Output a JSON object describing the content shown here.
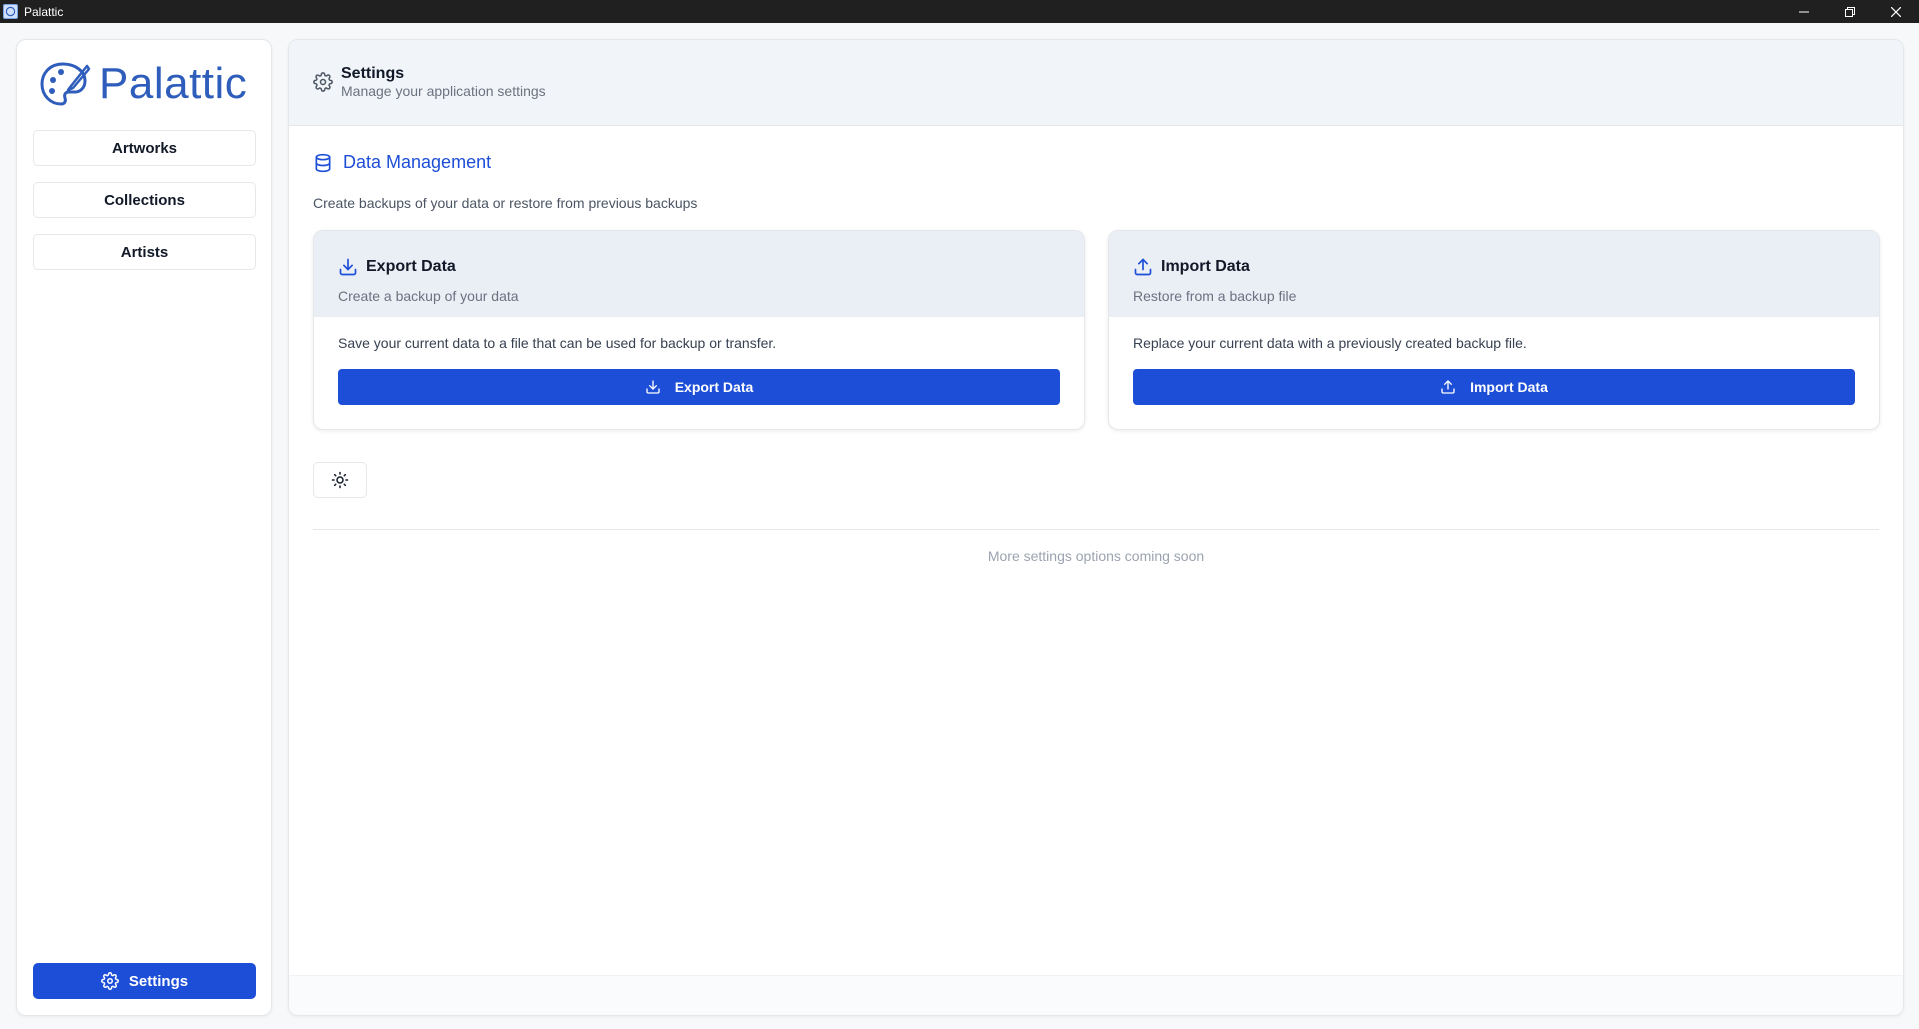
{
  "window": {
    "title": "Palattic"
  },
  "sidebar": {
    "logo_text": "Palattic",
    "items": [
      {
        "label": "Artworks"
      },
      {
        "label": "Collections"
      },
      {
        "label": "Artists"
      }
    ],
    "settings_label": "Settings"
  },
  "header": {
    "title": "Settings",
    "subtitle": "Manage your application settings"
  },
  "data_management": {
    "title": "Data Management",
    "description": "Create backups of your data or restore from previous backups",
    "export": {
      "title": "Export Data",
      "subtitle": "Create a backup of your data",
      "body": "Save your current data to a file that can be used for backup or transfer.",
      "button_label": "Export Data"
    },
    "import": {
      "title": "Import Data",
      "subtitle": "Restore from a backup file",
      "body": "Replace your current data with a previously created backup file.",
      "button_label": "Import Data"
    }
  },
  "footer_note": "More settings options coming soon",
  "colors": {
    "accent": "#1d4ed8",
    "logo": "#2f5dbb",
    "titlebar": "#202020"
  },
  "icons": {
    "app": "palette-icon",
    "minimize": "minimize-icon",
    "restore": "restore-icon",
    "close": "close-icon",
    "header": "gear-icon",
    "section": "database-icon",
    "export": "download-icon",
    "import": "upload-icon",
    "theme": "sun-icon"
  }
}
